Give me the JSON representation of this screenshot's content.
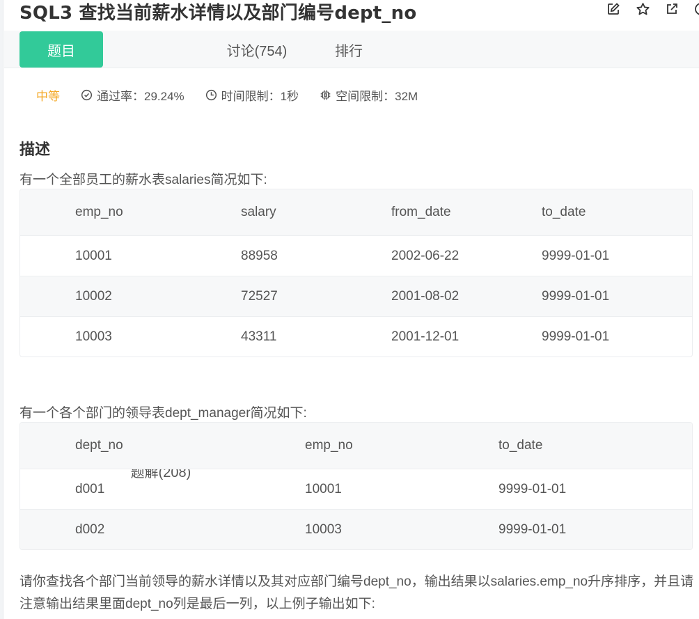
{
  "header": {
    "title": "SQL3  查找当前薪水详情以及部门编号dept_no",
    "icons": [
      "edit-icon",
      "star-icon",
      "external-link-icon",
      "more-icon"
    ]
  },
  "tabs": [
    {
      "label": "题目",
      "active": true
    },
    {
      "label": "题解(208)"
    },
    {
      "label": "讨论(754)"
    },
    {
      "label": "排行"
    }
  ],
  "meta": {
    "difficulty": "中等",
    "pass_rate": "通过率：29.24%",
    "time_limit": "时间限制：1秒",
    "space_limit": "空间限制：32M"
  },
  "description": {
    "title": "描述",
    "intro1": "有一个全部员工的薪水表salaries简况如下:",
    "intro2": "有一个各个部门的领导表dept_manager简况如下:",
    "question": "请你查找各个部门当前领导的薪水详情以及其对应部门编号dept_no，输出结果以salaries.emp_no升序排序，并且请注意输出结果里面dept_no列是最后一列，以上例子输出如下:"
  },
  "salaries_table": {
    "headers": [
      "emp_no",
      "salary",
      "from_date",
      "to_date"
    ],
    "rows": [
      [
        "10001",
        "88958",
        "2002-06-22",
        "9999-01-01"
      ],
      [
        "10002",
        "72527",
        "2001-08-02",
        "9999-01-01"
      ],
      [
        "10003",
        "43311",
        "2001-12-01",
        "9999-01-01"
      ]
    ]
  },
  "dept_manager_table": {
    "headers": [
      "dept_no",
      "emp_no",
      "to_date"
    ],
    "rows": [
      [
        "d001",
        "10001",
        "9999-01-01"
      ],
      [
        "d002",
        "10003",
        "9999-01-01"
      ]
    ]
  },
  "colors": {
    "accent": "#32ca99",
    "difficulty": "#f4a826"
  }
}
